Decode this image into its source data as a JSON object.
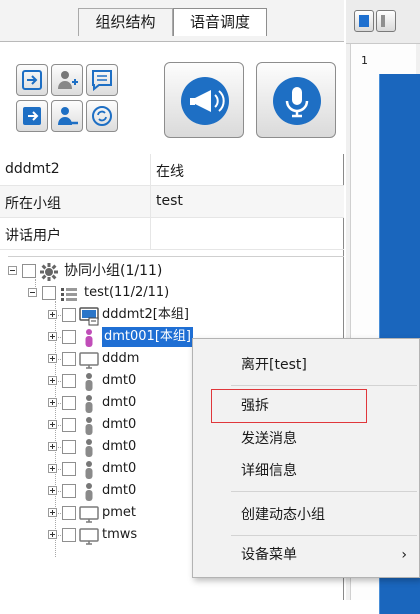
{
  "tabs": [
    {
      "label": "组织结构"
    },
    {
      "label": "语音调度"
    }
  ],
  "toolbar": {
    "small_buttons": [
      {
        "icon": "join-group-icon"
      },
      {
        "icon": "add-user-icon"
      },
      {
        "icon": "message-icon"
      },
      {
        "icon": "exit-group-icon"
      },
      {
        "icon": "remove-user-icon"
      },
      {
        "icon": "refresh-icon"
      }
    ],
    "broadcast_icon": "broadcast-icon",
    "talk_icon": "microphone-icon"
  },
  "info": [
    {
      "label": "dddmt2",
      "value": "在线"
    },
    {
      "label": "所在小组",
      "value": "test"
    },
    {
      "label": "讲话用户",
      "value": ""
    }
  ],
  "tree": {
    "root": "协同小组(1/11)",
    "group": "test(11/2/11)",
    "items": [
      {
        "label": "dddmt2[本组]",
        "icon": "terminal-icon"
      },
      {
        "label": "dmt001[本组]",
        "icon": "person-icon",
        "selected": true
      },
      {
        "label": "dddm",
        "icon": "monitor-icon"
      },
      {
        "label": "dmt0",
        "icon": "person-icon"
      },
      {
        "label": "dmt0",
        "icon": "person-icon"
      },
      {
        "label": "dmt0",
        "icon": "person-icon"
      },
      {
        "label": "dmt0",
        "icon": "person-icon"
      },
      {
        "label": "dmt0",
        "icon": "person-icon"
      },
      {
        "label": "dmt0",
        "icon": "person-icon"
      },
      {
        "label": "pmet",
        "icon": "monitor-icon"
      },
      {
        "label": "tmws",
        "icon": "monitor-icon"
      }
    ]
  },
  "right_panel": {
    "number": "1"
  },
  "context_menu": {
    "items": [
      {
        "label": "离开[test]"
      },
      {
        "label": "强拆"
      },
      {
        "label": "发送消息"
      },
      {
        "label": "详细信息"
      },
      {
        "label": "创建动态小组"
      },
      {
        "label": "设备菜单",
        "submenu_arrow": "›"
      }
    ]
  },
  "colors": {
    "selection": "#1f6fd4",
    "highlight_border": "#e0373b",
    "panel_blue": "#1a66bd"
  }
}
